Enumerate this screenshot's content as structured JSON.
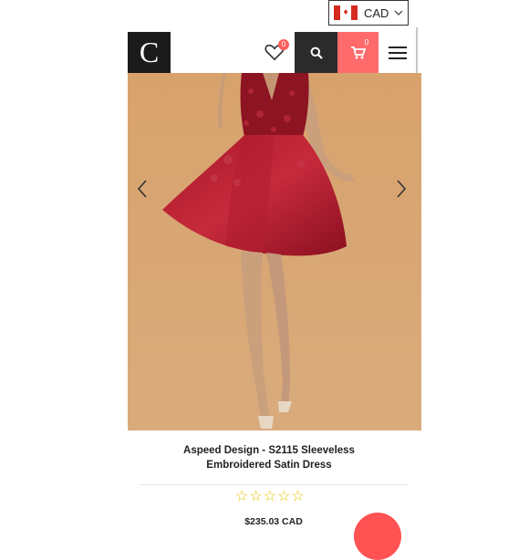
{
  "currency": {
    "code": "CAD",
    "flag_icon": "canada-flag-icon"
  },
  "header": {
    "logo_text": "C",
    "wishlist_count": "0",
    "cart_count": "0",
    "colors": {
      "dark": "#1b1b1b",
      "search_bg": "#2b2b2b",
      "cart_bg": "#ff6b6b"
    }
  },
  "product": {
    "title_line1": "Aspeed Design - S2115 Sleeveless",
    "title_line2": "Embroidered Satin Dress",
    "rating_stars": [
      "☆",
      "☆",
      "☆",
      "☆",
      "☆"
    ],
    "rating_value": 0,
    "price": "$235.03 CAD"
  },
  "gallery": {
    "prev_icon": "chevron-left-icon",
    "next_icon": "chevron-right-icon"
  },
  "colors": {
    "accent": "#ff5252",
    "star": "#e7c400",
    "backdrop": "#d9a46f"
  }
}
